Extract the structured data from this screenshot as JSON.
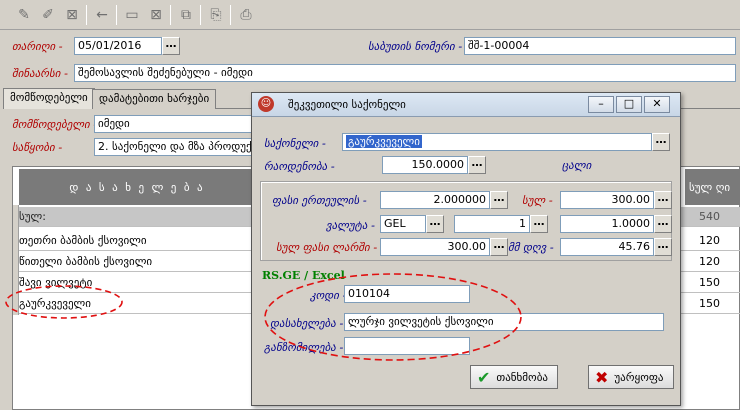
{
  "toolbar": {
    "icons": [
      "edit-icon",
      "open-icon",
      "delete-icon",
      "back-icon",
      "new-doc-icon",
      "delete-doc-icon",
      "copy-icon",
      "import-icon",
      "print-icon"
    ]
  },
  "form": {
    "date_label": "თარიღი -",
    "date_value": "05/01/2016",
    "invoice_label": "საბუთის ნომერი -",
    "invoice_value": "შშ-1-00004",
    "content_label": "შინაარსი -",
    "content_value": "შემოსავლის შეძენებული - იმედი"
  },
  "tabs": [
    {
      "label": "მომწოდებელი"
    },
    {
      "label": "დამატებითი ხარჯები"
    }
  ],
  "supplier": {
    "supplier_label": "მომწოდებელი -",
    "supplier_value": "იმედი",
    "account_label": "საწყობი -",
    "account_value": "2. საქონელი და მზა პროდუქ"
  },
  "grid": {
    "col_name": "დ ა ს ა ხ ე ლ ე ბ ა",
    "col_total": "სულ ღი",
    "sum_label": "სულ:",
    "sum_value": "540",
    "rows": [
      {
        "name": "თეთრი ბამბის ქსოვილი",
        "value": "120"
      },
      {
        "name": "წითელი ბამბის ქსოვილი",
        "value": "120"
      },
      {
        "name": "შავი ვილვეტი",
        "value": "150"
      },
      {
        "name": "გაურკვეველი",
        "value": "150"
      }
    ]
  },
  "dialog": {
    "title": "შეკვეთილი საქონელი",
    "item_label": "საქონელი -",
    "item_value": "გაურკვეველი",
    "qty_label": "რაოდენობა -",
    "qty_value": "150.0000",
    "unit_label": "ცალი",
    "price_label": "ფასი ერთეულის -",
    "price_value": "2.000000",
    "total_label": "სულ -",
    "total_value": "300.00",
    "currency_label": "ვალუტა -",
    "currency_value": "GEL",
    "rate_count": "1",
    "rate_value": "1.0000",
    "lari_label": "სულ ფასი ლარში -",
    "lari_value": "300.00",
    "vat_label": "მმ დღვ -",
    "vat_value": "45.76",
    "rsge_label": "RS.GE / Excel",
    "code_label": "კოდი -",
    "code_value": "010104",
    "name_label": "დასახელება -",
    "name_value": "ლურჯი ვილვეტის ქსოვილი",
    "unit2_label": "განზომილება -",
    "unit2_value": "",
    "ok_label": "თანხმობა",
    "cancel_label": "უარყოფა",
    "colors": {
      "highlight": "#3366cc",
      "ok": "#1a9a2a",
      "cancel": "#c00000",
      "annotation": "#e01010"
    }
  }
}
